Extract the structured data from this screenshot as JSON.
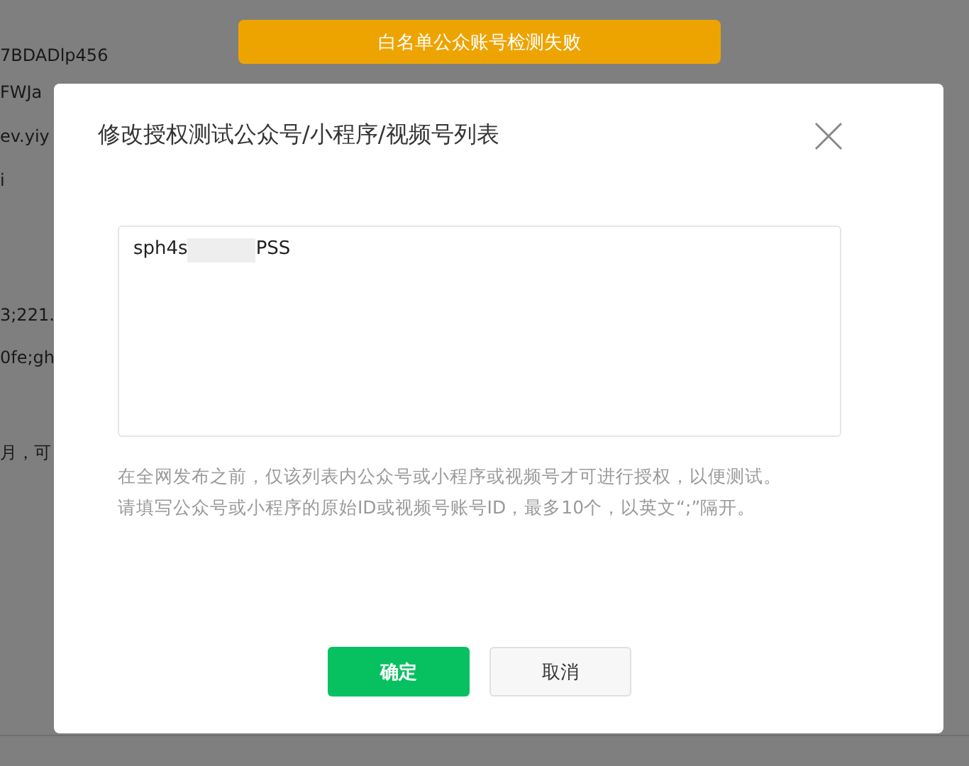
{
  "background_page": {
    "lines": [
      "7BDADlp456",
      "FWJa",
      "ev.yiy",
      "i",
      "3;221.",
      "0fe;gh",
      "月，可"
    ]
  },
  "toast": {
    "text": "白名单公众账号检测失败"
  },
  "dialog": {
    "title": "修改授权测试公众号/小程序/视频号列表",
    "field": {
      "value_start": "sph4s",
      "value_end": "PSS"
    },
    "hint_lines": [
      "在全网发布之前，仅该列表内公众号或小程序或视频号才可进行授权，以便测试。",
      "请填写公众号或小程序的原始ID或视频号账号ID，最多10个，以英文“;”隔开。"
    ],
    "buttons": [
      {
        "label": "确定",
        "kind": "primary"
      },
      {
        "label": "取消",
        "kind": "default"
      }
    ]
  }
}
